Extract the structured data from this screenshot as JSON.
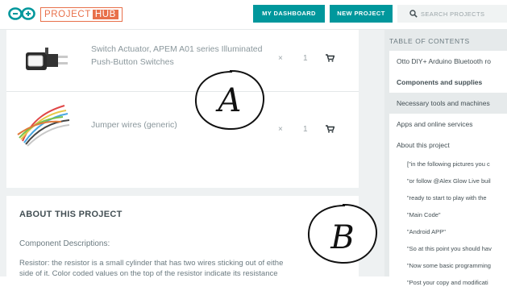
{
  "header": {
    "logo_text": "PROJECT",
    "logo_hub": "HUB",
    "dashboard_label": "MY DASHBOARD",
    "new_project_label": "NEW PROJECT",
    "search_placeholder": "SEARCH PROJECTS"
  },
  "parts": [
    {
      "name": "Switch Actuator, APEM A01 series Illuminated Push-Button Switches",
      "times": "×",
      "qty": "1"
    },
    {
      "name": "Jumper wires (generic)",
      "times": "×",
      "qty": "1"
    }
  ],
  "about": {
    "title": "ABOUT THIS PROJECT",
    "subtitle": "Component Descriptions:",
    "lines": [
      "Resistor: the resistor is a small cylinder that has two wires sticking out of eithe",
      "side of it. Color coded values on the top of the resistor indicate its resistance"
    ]
  },
  "toc": {
    "title": "TABLE OF CONTENTS",
    "items": [
      "Otto DIY+ Arduino Bluetooth ro",
      "Components and supplies",
      "Necessary tools and machines",
      "Apps and online services",
      "About this project"
    ],
    "subitems": [
      "[\"in the following pictures you c",
      "\"or follow @Alex Glow Live buil",
      "\"ready to start to play with the",
      "\"Main Code\"",
      "\"Android APP\"",
      "\"So at this point you should hav",
      "\"Now some basic programming",
      "\"Post your copy and modificati"
    ]
  },
  "annotations": {
    "a": "A",
    "b": "B"
  },
  "colors": {
    "accent": "#00979c",
    "brand": "#e8704a"
  }
}
